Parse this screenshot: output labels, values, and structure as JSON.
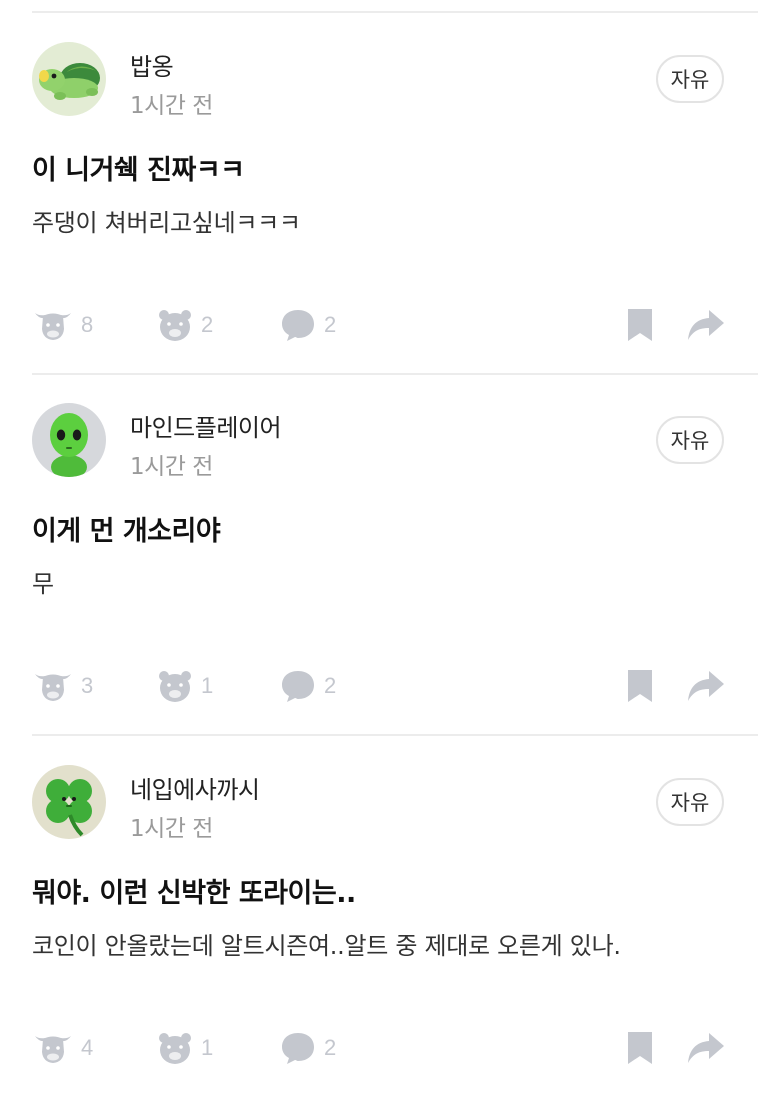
{
  "posts": [
    {
      "author": "밥옹",
      "time": "1시간 전",
      "tag": "자유",
      "title": "이 니거쉑 진짜ㅋㅋ",
      "body": "주댕이 쳐버리고싶네ㅋㅋㅋ",
      "likes": "8",
      "dislikes": "2",
      "comments": "2",
      "avatar_icon": "turtle-avatar-icon"
    },
    {
      "author": "마인드플레이어",
      "time": "1시간 전",
      "tag": "자유",
      "title": "이게 먼 개소리야",
      "body": "무",
      "likes": "3",
      "dislikes": "1",
      "comments": "2",
      "avatar_icon": "alien-avatar-icon"
    },
    {
      "author": "네입에사까시",
      "time": "1시간 전",
      "tag": "자유",
      "title": "뭐야. 이런 신박한 또라이는..",
      "body": "코인이 안올랐는데 알트시즌여..알트 중 제대로 오른게 있나.",
      "likes": "4",
      "dislikes": "1",
      "comments": "2",
      "avatar_icon": "clover-avatar-icon"
    }
  ],
  "colors": {
    "icon_gray": "#c4c7ce",
    "divider": "#ececec",
    "time_gray": "#9a9a9a"
  },
  "icons": [
    "bull-icon",
    "bear-icon",
    "comment-icon",
    "bookmark-icon",
    "share-icon"
  ]
}
